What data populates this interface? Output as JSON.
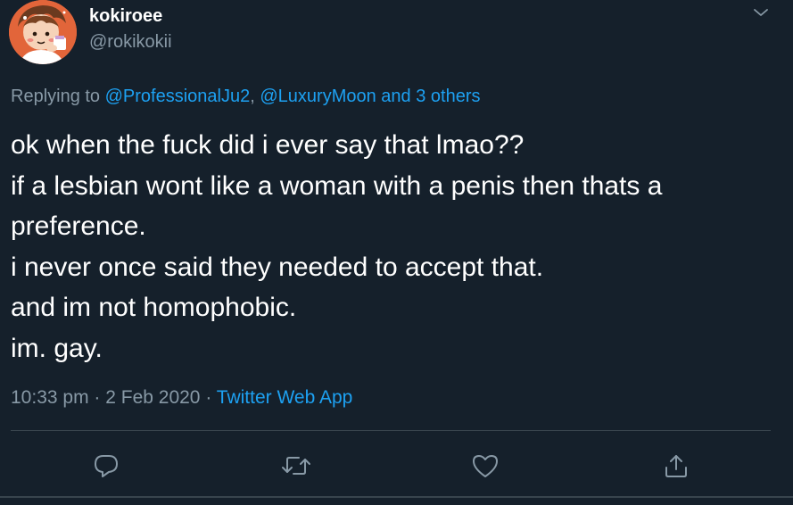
{
  "tweet": {
    "author": {
      "display_name": "kokiroee",
      "handle": "@rokikokii",
      "avatar_icon": "avatar-cartoon"
    },
    "caret_icon": "chevron-down-icon",
    "reply": {
      "prefix": "Replying to ",
      "mention_1": "@ProfessionalJu2",
      "separator": ", ",
      "mention_2": "@LuxuryMoon",
      "conjunction": " and ",
      "others": "3 others"
    },
    "text_lines": [
      "ok when the fuck did i ever say that lmao??",
      "if a lesbian wont like a woman with a penis then thats a",
      "preference.",
      "i never once said they needed to accept that.",
      "and im not homophobic.",
      "im. gay."
    ],
    "meta": {
      "time": "10:33 pm",
      "dot_1": " · ",
      "date": "2 Feb 2020",
      "dot_2": " · ",
      "source": "Twitter Web App"
    },
    "actions": [
      "reply-icon",
      "retweet-icon",
      "like-icon",
      "share-icon"
    ]
  },
  "colors": {
    "background": "#15202b",
    "text": "#ffffff",
    "muted": "#8899a6",
    "link": "#1da1f2",
    "border": "#38444d",
    "avatar_bg": "#e2653a"
  }
}
